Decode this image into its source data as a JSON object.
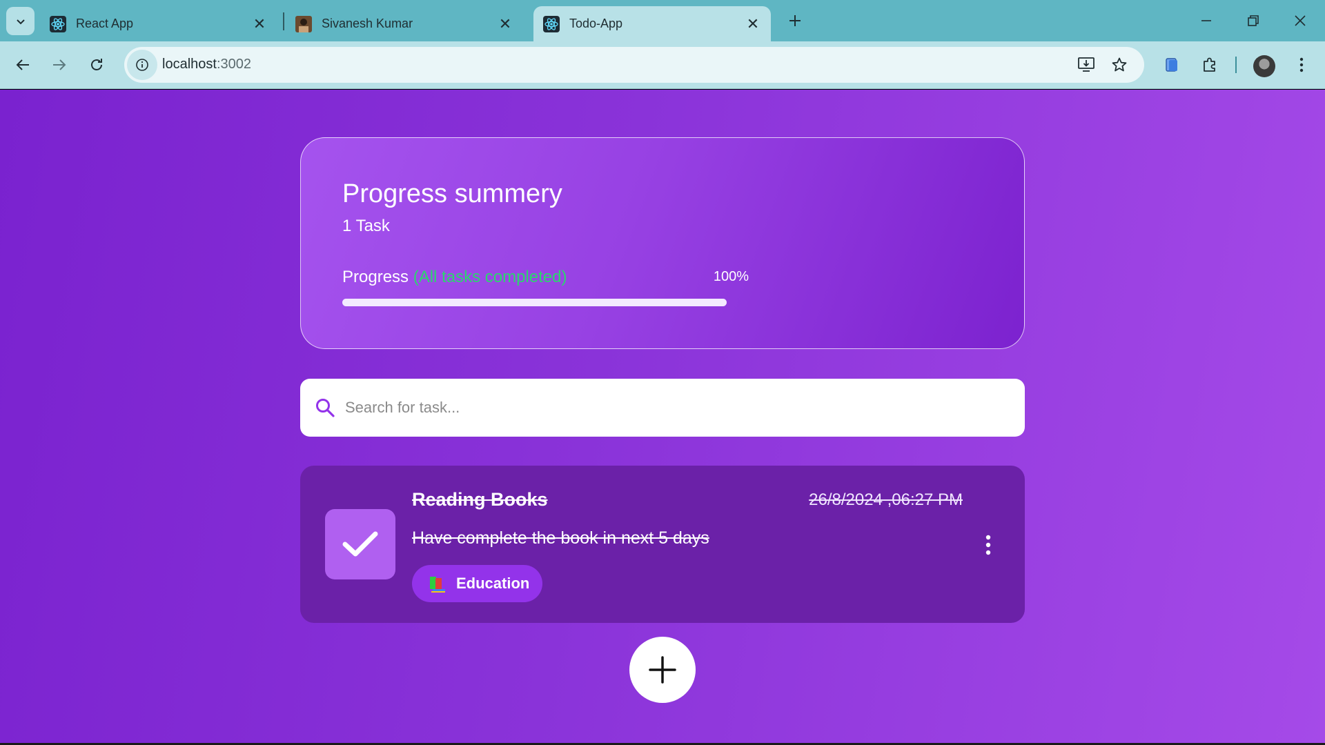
{
  "browser": {
    "tabs": [
      {
        "title": "React App",
        "favicon": "react-icon",
        "active": false
      },
      {
        "title": "Sivanesh Kumar",
        "favicon": "profile-photo-icon",
        "active": false
      },
      {
        "title": "Todo-App",
        "favicon": "react-icon",
        "active": true
      }
    ],
    "url": {
      "host": "localhost",
      "port": ":3002"
    }
  },
  "summary": {
    "title": "Progress summery",
    "task_count": "1 Task",
    "progress_label": "Progress",
    "progress_status": "(All tasks completed)",
    "progress_percent_text": "100%",
    "progress_value": 1.0
  },
  "search": {
    "placeholder": "Search for task..."
  },
  "tasks": [
    {
      "title": "Reading Books",
      "date": "26/8/2024 ,06:27 PM",
      "description": "Have complete the book in next 5 days",
      "category": "Education",
      "completed": true
    }
  ],
  "colors": {
    "accent": "#9333ea",
    "task_card": "#6b21a8",
    "completed_text": "#2bd66e",
    "chrome": "#5fb6c3"
  }
}
